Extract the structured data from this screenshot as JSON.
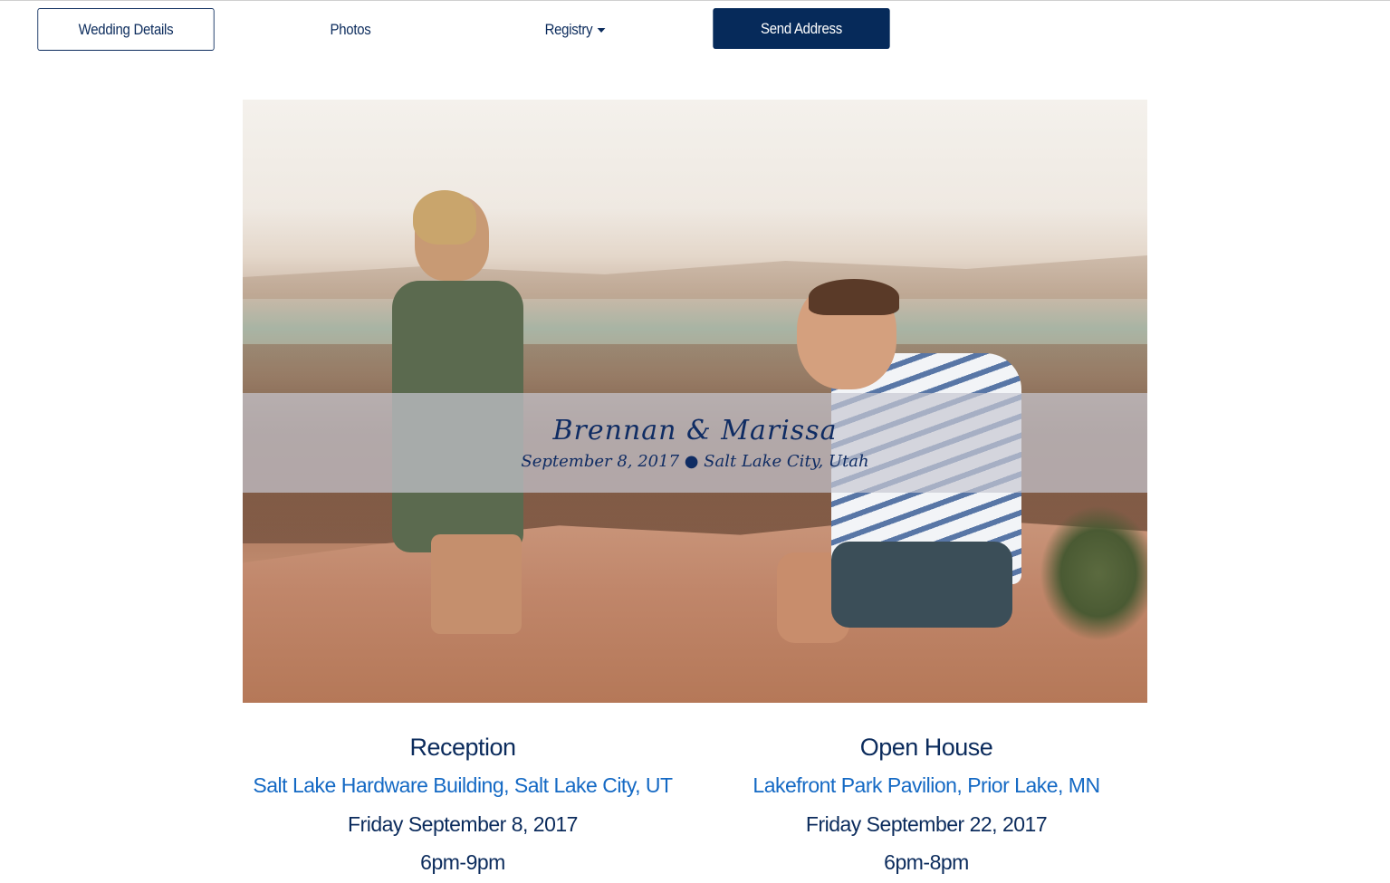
{
  "nav": {
    "items": [
      {
        "label": "Wedding Details"
      },
      {
        "label": "Photos"
      },
      {
        "label": "Registry"
      },
      {
        "label": "Send Address"
      }
    ]
  },
  "hero": {
    "names": "Brennan & Marissa",
    "subtitle": "September 8, 2017 ● Salt Lake City, Utah"
  },
  "events": [
    {
      "title": "Reception",
      "location": "Salt Lake Hardware Building, Salt Lake City, UT",
      "date": "Friday September 8, 2017",
      "time": "6pm-9pm"
    },
    {
      "title": "Open House",
      "location": "Lakefront Park Pavilion, Prior Lake, MN",
      "date": "Friday September 22, 2017",
      "time": "6pm-8pm"
    }
  ],
  "colors": {
    "navy": "#062a5a",
    "link_blue": "#1469c4",
    "banner_overlay": "rgba(200,200,210,0.7)"
  }
}
